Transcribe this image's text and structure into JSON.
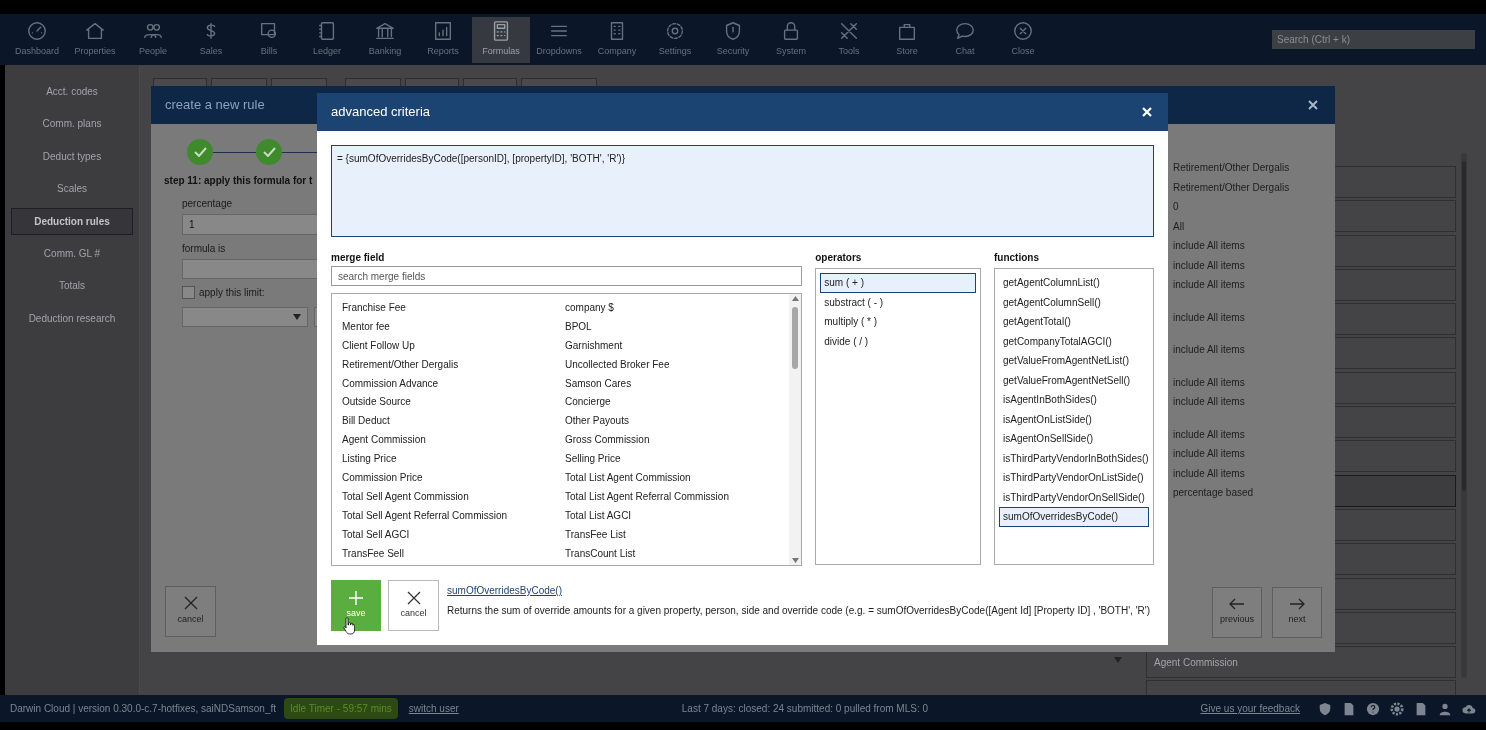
{
  "nav": {
    "items": [
      {
        "label": "Dashboard",
        "selected": false
      },
      {
        "label": "Properties",
        "selected": false
      },
      {
        "label": "People",
        "selected": false
      },
      {
        "label": "Sales",
        "selected": false
      },
      {
        "label": "Bills",
        "selected": false
      },
      {
        "label": "Ledger",
        "selected": false
      },
      {
        "label": "Banking",
        "selected": false
      },
      {
        "label": "Reports",
        "selected": false
      },
      {
        "label": "Formulas",
        "selected": true
      },
      {
        "label": "Dropdowns",
        "selected": false
      },
      {
        "label": "Company",
        "selected": false
      },
      {
        "label": "Settings",
        "selected": false
      },
      {
        "label": "Security",
        "selected": false
      },
      {
        "label": "System",
        "selected": false
      },
      {
        "label": "Tools",
        "selected": false
      },
      {
        "label": "Store",
        "selected": false
      },
      {
        "label": "Chat",
        "selected": false
      },
      {
        "label": "Close",
        "selected": false
      }
    ],
    "search": {
      "placeholder": "Search (Ctrl + k)"
    }
  },
  "sidebar": {
    "items": [
      {
        "label": "Acct. codes",
        "selected": false
      },
      {
        "label": "Comm. plans",
        "selected": false
      },
      {
        "label": "Deduct types",
        "selected": false
      },
      {
        "label": "Scales",
        "selected": false
      },
      {
        "label": "Deduction rules",
        "selected": true
      },
      {
        "label": "Comm. GL #",
        "selected": false
      },
      {
        "label": "Totals",
        "selected": false
      },
      {
        "label": "Deduction research",
        "selected": false
      }
    ]
  },
  "background_list": {
    "rows": [
      {
        "selected": false
      },
      {
        "selected": false
      },
      {
        "selected": false
      },
      {
        "selected": false
      },
      {
        "selected": false
      },
      {
        "selected": false
      },
      {
        "selected": false
      },
      {
        "selected": false
      },
      {
        "selected": false
      },
      {
        "selected": true
      },
      {
        "selected": false
      },
      {
        "selected": false
      },
      {
        "selected": false
      },
      {
        "selected": false
      },
      {
        "label": "Agent Commission",
        "selected": false
      },
      {
        "selected": false
      }
    ]
  },
  "create_rule_dialog": {
    "title": "create a new rule",
    "steps": [
      {
        "done": true
      },
      {
        "done": true
      }
    ],
    "step_title": "step 11: apply this formula for t",
    "percentage": {
      "label": "percentage",
      "value": "1"
    },
    "formula": {
      "label": "formula is"
    },
    "limit": {
      "label": "apply this limit:",
      "checked": false
    },
    "cancel": "cancel",
    "summary_groups": [
      [
        "Retirement/Other Dergalis",
        "Retirement/Other Dergalis",
        "0",
        "All",
        "include All items",
        "include All items",
        "include All items"
      ],
      [
        "include All items"
      ],
      [
        "include All items"
      ],
      [
        "include All items",
        "include All items"
      ],
      [
        "include All items",
        "include All items",
        "include All items",
        "percentage based"
      ]
    ],
    "previous": "previous",
    "next": "next"
  },
  "advanced_criteria": {
    "title": "advanced criteria",
    "formula": "= {sumOfOverridesByCode([personID], [propertyID], 'BOTH', 'R')}",
    "merge_field": {
      "label": "merge field",
      "placeholder": "search merge fields",
      "rows": [
        [
          "Franchise Fee",
          "company $"
        ],
        [
          "Mentor fee",
          "BPOL"
        ],
        [
          "Client Follow Up",
          "Garnishment"
        ],
        [
          "Retirement/Other Dergalis",
          "Uncollected Broker Fee"
        ],
        [
          "Commission Advance",
          "Samson Cares"
        ],
        [
          "Outside Source",
          "Concierge"
        ],
        [
          "Bill Deduct",
          "Other Payouts"
        ],
        [
          "Agent Commission",
          "Gross Commission"
        ],
        [
          "Listing Price",
          "Selling Price"
        ],
        [
          "Commission Price",
          "Total List Agent Commission"
        ],
        [
          "Total Sell Agent Commission",
          "Total List Agent Referral Commission"
        ],
        [
          "Total Sell Agent Referral Commission",
          "Total List AGCI"
        ],
        [
          "Total Sell AGCI",
          "TransFee List"
        ],
        [
          "TransFee Sell",
          "TransCount List"
        ]
      ]
    },
    "operators": {
      "label": "operators",
      "items": [
        {
          "label": "sum ( + )",
          "selected": true
        },
        {
          "label": "substract ( - )",
          "selected": false
        },
        {
          "label": "multiply ( * )",
          "selected": false
        },
        {
          "label": "divide ( / )",
          "selected": false
        }
      ]
    },
    "functions": {
      "label": "functions",
      "items": [
        {
          "label": "getAgentColumnList()",
          "selected": false
        },
        {
          "label": "getAgentColumnSell()",
          "selected": false
        },
        {
          "label": "getAgentTotal()",
          "selected": false
        },
        {
          "label": "getCompanyTotalAGCI()",
          "selected": false
        },
        {
          "label": "getValueFromAgentNetList()",
          "selected": false
        },
        {
          "label": "getValueFromAgentNetSell()",
          "selected": false
        },
        {
          "label": "isAgentInBothSides()",
          "selected": false
        },
        {
          "label": "isAgentOnListSide()",
          "selected": false
        },
        {
          "label": "isAgentOnSellSide()",
          "selected": false
        },
        {
          "label": "isThirdPartyVendorInBothSides()",
          "selected": false
        },
        {
          "label": "isThirdPartyVendorOnListSide()",
          "selected": false
        },
        {
          "label": "isThirdPartyVendorOnSellSide()",
          "selected": false
        },
        {
          "label": "sumOfOverridesByCode()",
          "selected": true
        }
      ]
    },
    "save": "save",
    "cancel": "cancel",
    "help": {
      "name": "sumOfOverridesByCode()",
      "description": "Returns the sum of override amounts for a given property, person, side and override code (e.g. = sumOfOverridesByCode([Agent Id] [Property ID] , 'BOTH', 'R')"
    }
  },
  "status_bar": {
    "version": "Darwin Cloud | version 0.30.0-c.7-hotfixes, saiNDSamson_ft",
    "idle_timer": "Idle Timer - 59:57 mins",
    "switch_user": "switch user",
    "stats": "Last 7 days: closed: 24 submitted: 0 pulled from MLS: 0",
    "feedback": "Give us your feedback"
  }
}
